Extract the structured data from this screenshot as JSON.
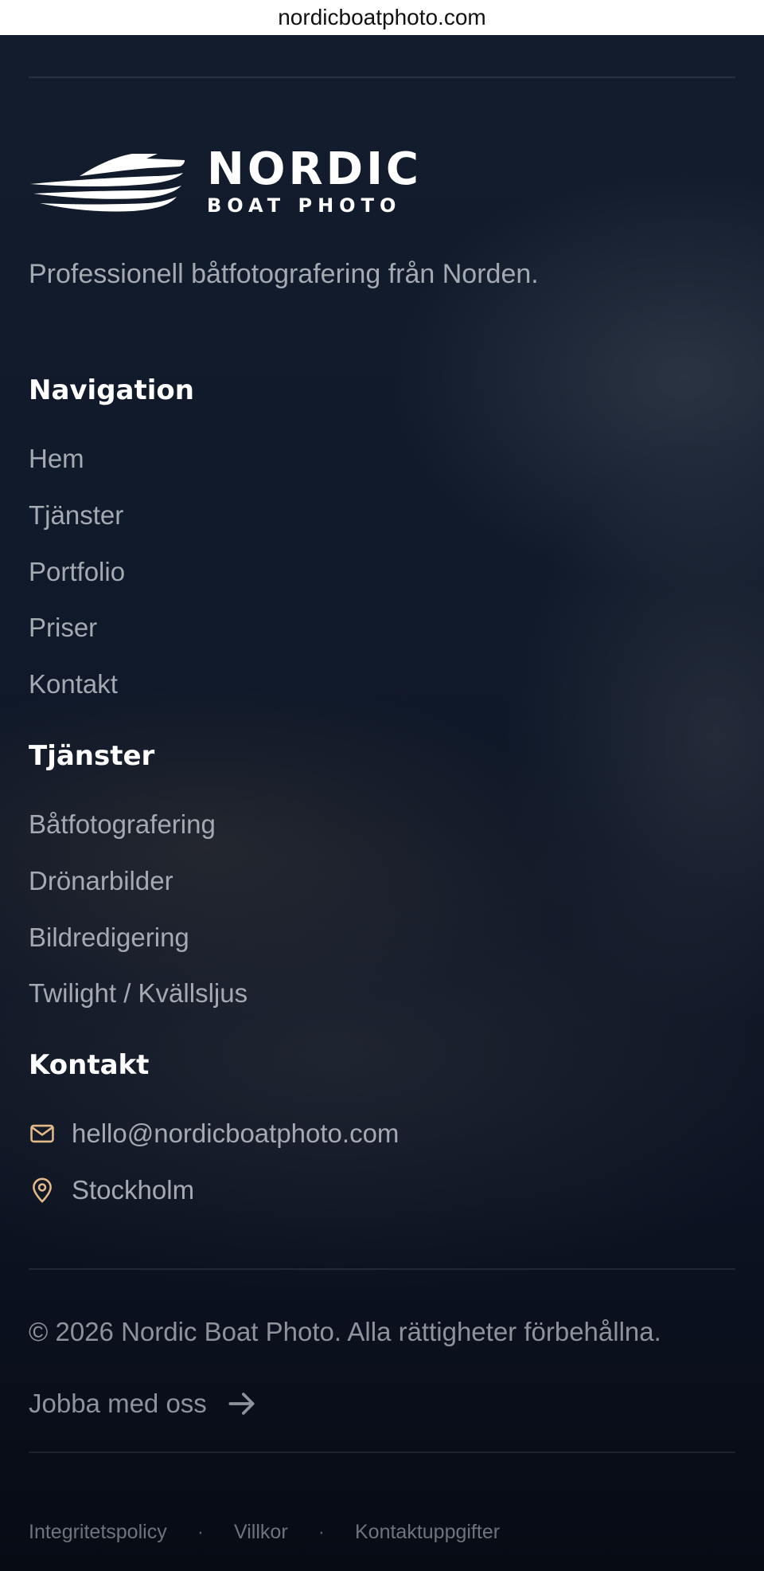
{
  "browser": {
    "url": "nordicboatphoto.com"
  },
  "brand": {
    "name": "NORDIC",
    "sub": "BOAT PHOTO",
    "tagline": "Professionell båtfotografering från Norden."
  },
  "navigation": {
    "heading": "Navigation",
    "items": [
      "Hem",
      "Tjänster",
      "Portfolio",
      "Priser",
      "Kontakt"
    ]
  },
  "services": {
    "heading": "Tjänster",
    "items": [
      "Båtfotografering",
      "Drönarbilder",
      "Bildredigering",
      "Twilight / Kvällsljus"
    ]
  },
  "contact": {
    "heading": "Kontakt",
    "email": "hello@nordicboatphoto.com",
    "location": "Stockholm",
    "icon_color": "#e3b98a"
  },
  "bottom": {
    "copyright": "© 2026 Nordic Boat Photo. Alla rättigheter förbehållna.",
    "careers_link": "Jobba med oss",
    "legal_links": [
      "Integritetspolicy",
      "Villkor",
      "Kontaktuppgifter"
    ],
    "separator": "·"
  },
  "icons": {
    "email": "mail-icon",
    "location": "map-pin-icon",
    "careers": "arrow-right-icon",
    "logo": "boat-logo-icon"
  }
}
